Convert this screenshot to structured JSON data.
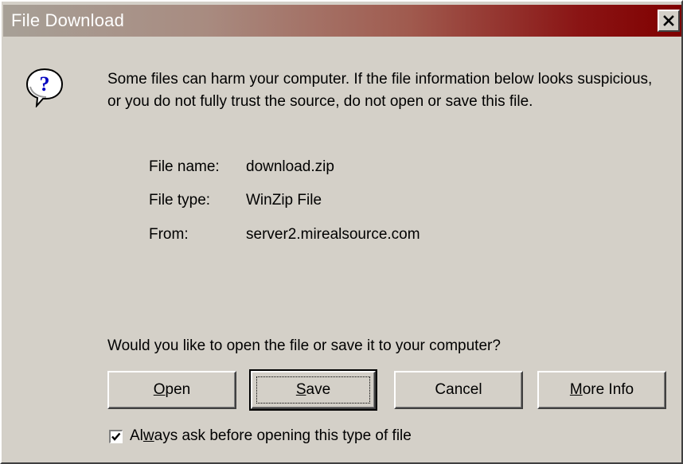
{
  "window": {
    "title": "File Download",
    "close_label": "x"
  },
  "icons": {
    "question": "question-icon",
    "close": "close-icon",
    "check": "check-icon"
  },
  "message": "Some files can harm your computer. If the file information below looks suspicious, or you do not fully trust the source, do not open or save this file.",
  "file_info": {
    "name_label": "File name:",
    "name_value": "download.zip",
    "type_label": "File type:",
    "type_value": "WinZip File",
    "from_label": "From:",
    "from_value": "server2.mirealsource.com"
  },
  "question": "Would you like to open the file or save it to your computer?",
  "buttons": {
    "open": {
      "pre": "",
      "mnemonic": "O",
      "post": "pen"
    },
    "save": {
      "pre": "",
      "mnemonic": "S",
      "post": "ave"
    },
    "cancel": "Cancel",
    "more_info": {
      "pre": "",
      "mnemonic": "M",
      "post": "ore Info"
    }
  },
  "always_ask": {
    "checked": true,
    "pre": "Al",
    "mnemonic": "w",
    "post": "ays ask before opening this type of file"
  },
  "colors": {
    "dialog_bg": "#d4d0c8",
    "title_gradient_start": "#a7a097",
    "title_gradient_end": "#800000",
    "title_text": "#ffffff"
  }
}
